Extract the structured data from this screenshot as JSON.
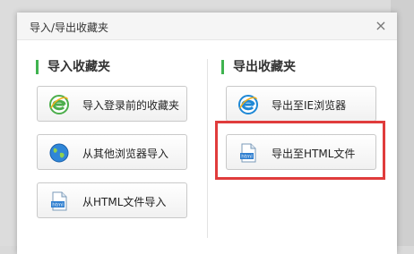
{
  "dialog": {
    "title": "导入/导出收藏夹",
    "close_glyph": "×"
  },
  "import_section": {
    "heading": "导入收藏夹",
    "buttons": [
      {
        "label": "导入登录前的收藏夹",
        "icon": "ie-logo-icon"
      },
      {
        "label": "从其他浏览器导入",
        "icon": "globe-icon"
      },
      {
        "label": "从HTML文件导入",
        "icon": "html-file-icon"
      }
    ]
  },
  "export_section": {
    "heading": "导出收藏夹",
    "buttons": [
      {
        "label": "导出至IE浏览器",
        "icon": "ie-logo-icon"
      },
      {
        "label": "导出至HTML文件",
        "icon": "html-file-icon"
      }
    ]
  },
  "icon_text": {
    "html_badge": "html"
  },
  "colors": {
    "section_accent": "#3fb34f",
    "highlight_border": "#e03c3c",
    "ie_blue": "#1e88d6",
    "ie_green": "#4cae4c"
  }
}
